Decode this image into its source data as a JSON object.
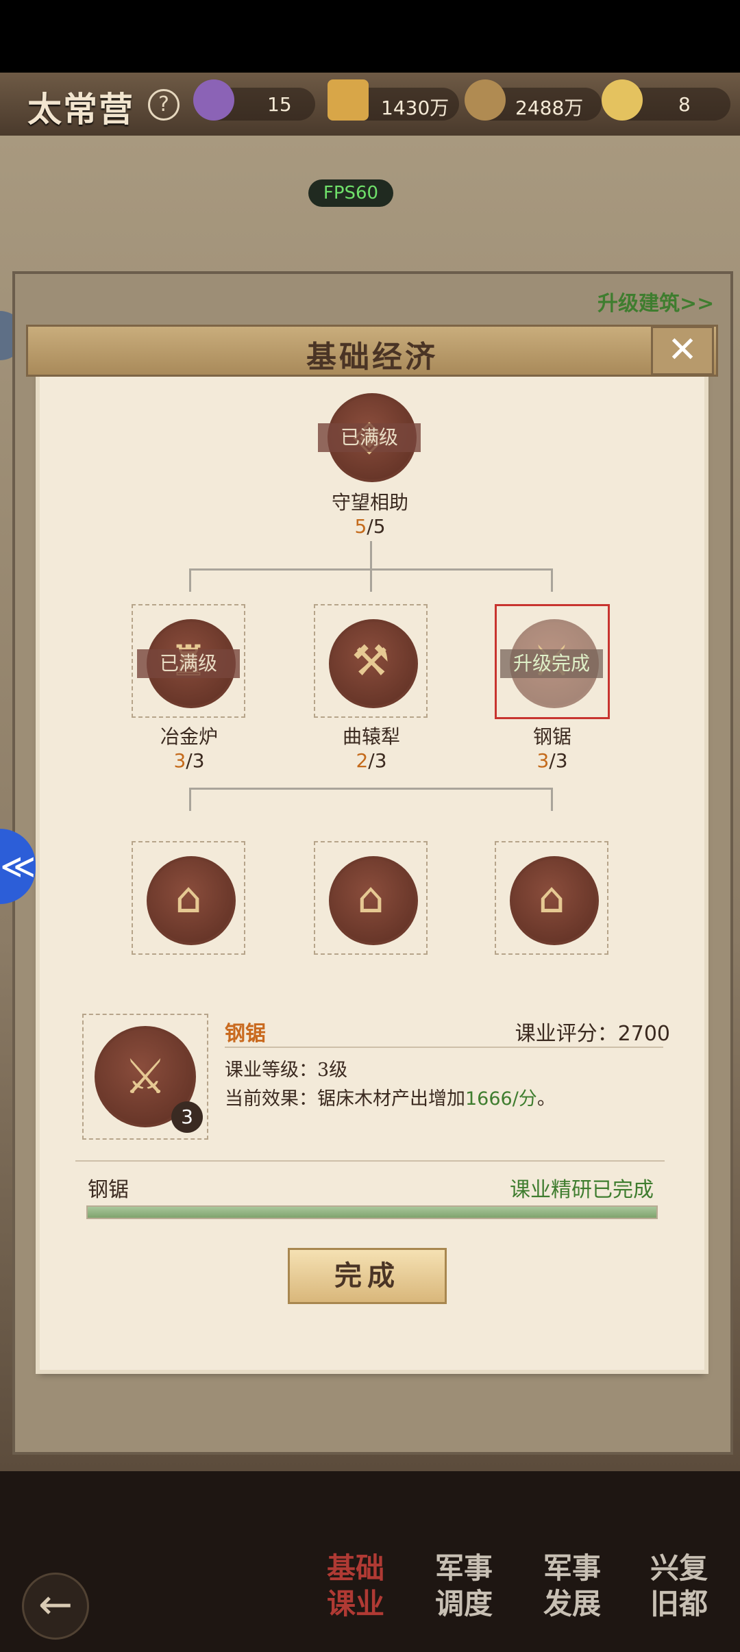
{
  "header": {
    "title": "太常营",
    "help_icon": "?",
    "resources": [
      {
        "name": "badge",
        "value": "15",
        "color": "#8b63b6"
      },
      {
        "name": "gold-bars",
        "value": "1430万",
        "color": "#d8a648"
      },
      {
        "name": "coins",
        "value": "2488万",
        "color": "#b08b52"
      },
      {
        "name": "ingot",
        "value": "8",
        "color": "#e4c25f"
      }
    ]
  },
  "fps": "FPS60",
  "upgrade_link": "升级建筑>>",
  "dialog": {
    "title": "基础经济",
    "close_icon": "✕",
    "tree": {
      "root": {
        "name": "守望相助",
        "current": "5",
        "max": "/5",
        "badge": "已满级",
        "icon": "shield-icon"
      },
      "tier2": [
        {
          "name": "冶金炉",
          "current": "3",
          "max": "/3",
          "badge": "已满级",
          "icon": "furnace-icon"
        },
        {
          "name": "曲辕犁",
          "current": "2",
          "max": "/3",
          "badge": "",
          "icon": "plow-icon"
        },
        {
          "name": "钢锯",
          "current": "3",
          "max": "/3",
          "badge": "升级完成",
          "icon": "saw-icon"
        }
      ],
      "tier3": [
        {
          "icon": "warehouse-ore-icon"
        },
        {
          "icon": "warehouse-goods-icon"
        },
        {
          "icon": "warehouse-wood-icon"
        }
      ]
    },
    "detail": {
      "name": "钢锯",
      "score_label": "课业评分：",
      "score_value": "2700",
      "level_text": "课业等级：3级",
      "effect_prefix": "当前效果：锯床木材产出增加",
      "effect_value": "1666/分",
      "effect_suffix": "。",
      "badge_level": "3"
    },
    "progress": {
      "label": "钢锯",
      "status": "课业精研已完成",
      "fraction": 1.0
    },
    "done_button": "完成"
  },
  "bottom_nav": [
    {
      "label_line1": "基础",
      "label_line2": "课业",
      "active": true
    },
    {
      "label_line1": "军事",
      "label_line2": "调度",
      "active": false
    },
    {
      "label_line1": "军事",
      "label_line2": "发展",
      "active": false
    },
    {
      "label_line1": "兴复",
      "label_line2": "旧都",
      "active": false
    }
  ],
  "back_icon": "←"
}
